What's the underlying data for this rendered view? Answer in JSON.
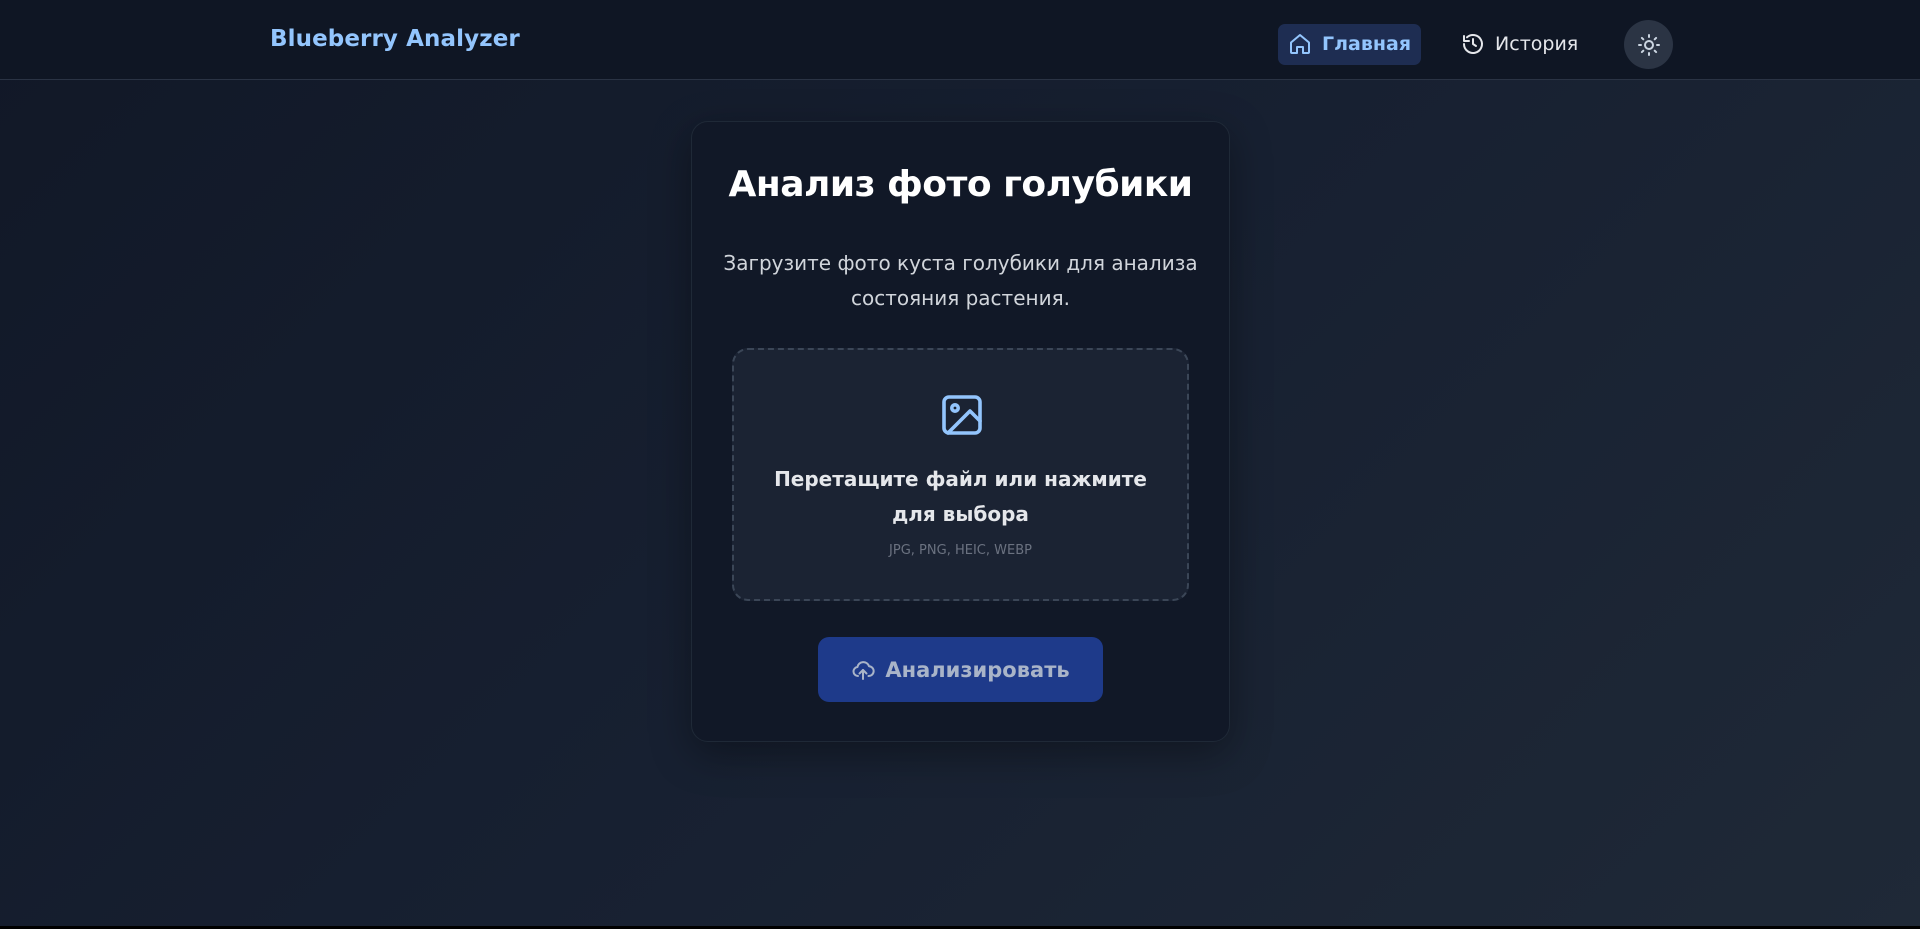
{
  "header": {
    "brand": "Blueberry Analyzer",
    "nav": {
      "home_label": "Главная",
      "history_label": "История"
    },
    "home_icon": "home-icon",
    "history_icon": "history-icon",
    "theme_icon": "sun-icon"
  },
  "card": {
    "title": "Анализ фото голубики",
    "subtitle": "Загрузите фото куста голубики для анализа состояния растения.",
    "dropzone": {
      "icon": "image-icon",
      "title": "Перетащите файл или нажмите для выбора",
      "formats": "JPG, PNG, HEIC, WEBP"
    },
    "analyze_button": {
      "label": "Анализировать",
      "icon": "cloud-upload-icon"
    }
  },
  "colors": {
    "accent": "#93c5fd",
    "button_bg": "#1e3a8a",
    "card_bg": "#111827",
    "page_bg": "#172031"
  }
}
